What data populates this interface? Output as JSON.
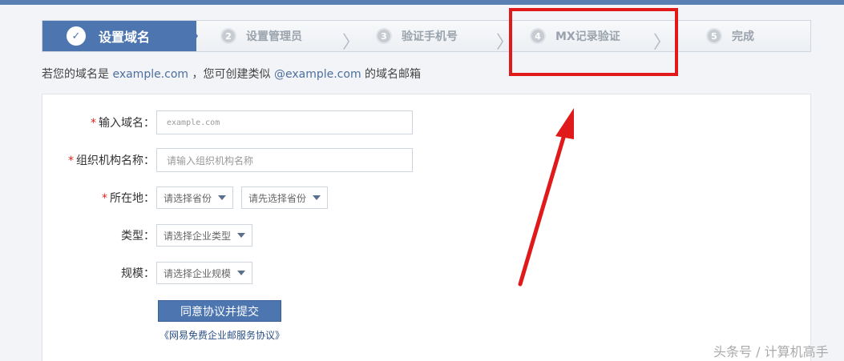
{
  "steps": [
    {
      "num": "✓",
      "label": "设置域名"
    },
    {
      "num": "2",
      "label": "设置管理员"
    },
    {
      "num": "3",
      "label": "验证手机号"
    },
    {
      "num": "4",
      "label": "MX记录验证"
    },
    {
      "num": "5",
      "label": "完成"
    }
  ],
  "hint": {
    "prefix": "若您的域名是",
    "domain": "example.com",
    "middle": "，您可创建类似",
    "email_domain": "@example.com",
    "suffix": "的域名邮箱"
  },
  "form": {
    "domain": {
      "required": "*",
      "label": "输入域名：",
      "placeholder": "example.com"
    },
    "org": {
      "required": "*",
      "label": "组织机构名称：",
      "placeholder": "请输入组织机构名称"
    },
    "location": {
      "required": "*",
      "label": "所在地：",
      "province": "请选择省份",
      "city": "请先选择省份"
    },
    "type": {
      "label": "类型：",
      "value": "请选择企业类型"
    },
    "scale": {
      "label": "规模：",
      "value": "请选择企业规模"
    },
    "submit_label": "同意协议并提交",
    "agreement_link": "《网易免费企业邮服务协议》"
  },
  "watermark": "头条号 / 计算机高手",
  "colors": {
    "accent": "#4d76b0",
    "annotation": "#e0191a"
  }
}
